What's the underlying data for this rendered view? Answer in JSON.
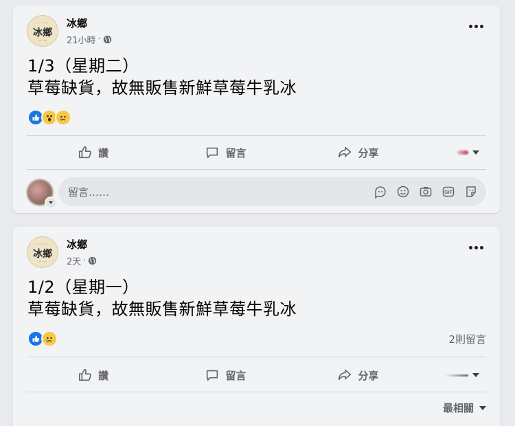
{
  "posts": [
    {
      "page_name": "冰鄉",
      "avatar_logo": "冰鄉",
      "time": "21小時",
      "separator": "·",
      "date_line": "1/3（星期二）",
      "text_line": "草莓缺貨，故無販售新鮮草莓牛乳冰",
      "reactions": [
        "like",
        "wow",
        "sad"
      ],
      "comment_count": "",
      "actions": {
        "like": "讚",
        "comment": "留言",
        "share": "分享"
      },
      "comment_placeholder": "留言……"
    },
    {
      "page_name": "冰鄉",
      "avatar_logo": "冰鄉",
      "time": "2天",
      "separator": "·",
      "date_line": "1/2（星期一）",
      "text_line": "草莓缺貨，故無販售新鮮草莓牛乳冰",
      "reactions": [
        "like",
        "sad"
      ],
      "comment_count": "2則留言",
      "actions": {
        "like": "讚",
        "comment": "留言",
        "share": "分享"
      },
      "sort_label": "最相關"
    }
  ],
  "icons": {
    "more": "more-horizontal-icon",
    "globe": "globe-icon",
    "like": "thumbs-up-icon",
    "comment": "comment-bubble-icon",
    "share": "share-arrow-icon",
    "avatar_sticker": "avatar-sticker-icon",
    "emoji": "emoji-icon",
    "camera": "camera-icon",
    "gif": "gif-icon",
    "sticker": "sticker-icon"
  },
  "colors": {
    "like_blue": "#1b74e4",
    "reaction_yellow": "#f7c841",
    "secondary_text": "#65676b"
  }
}
